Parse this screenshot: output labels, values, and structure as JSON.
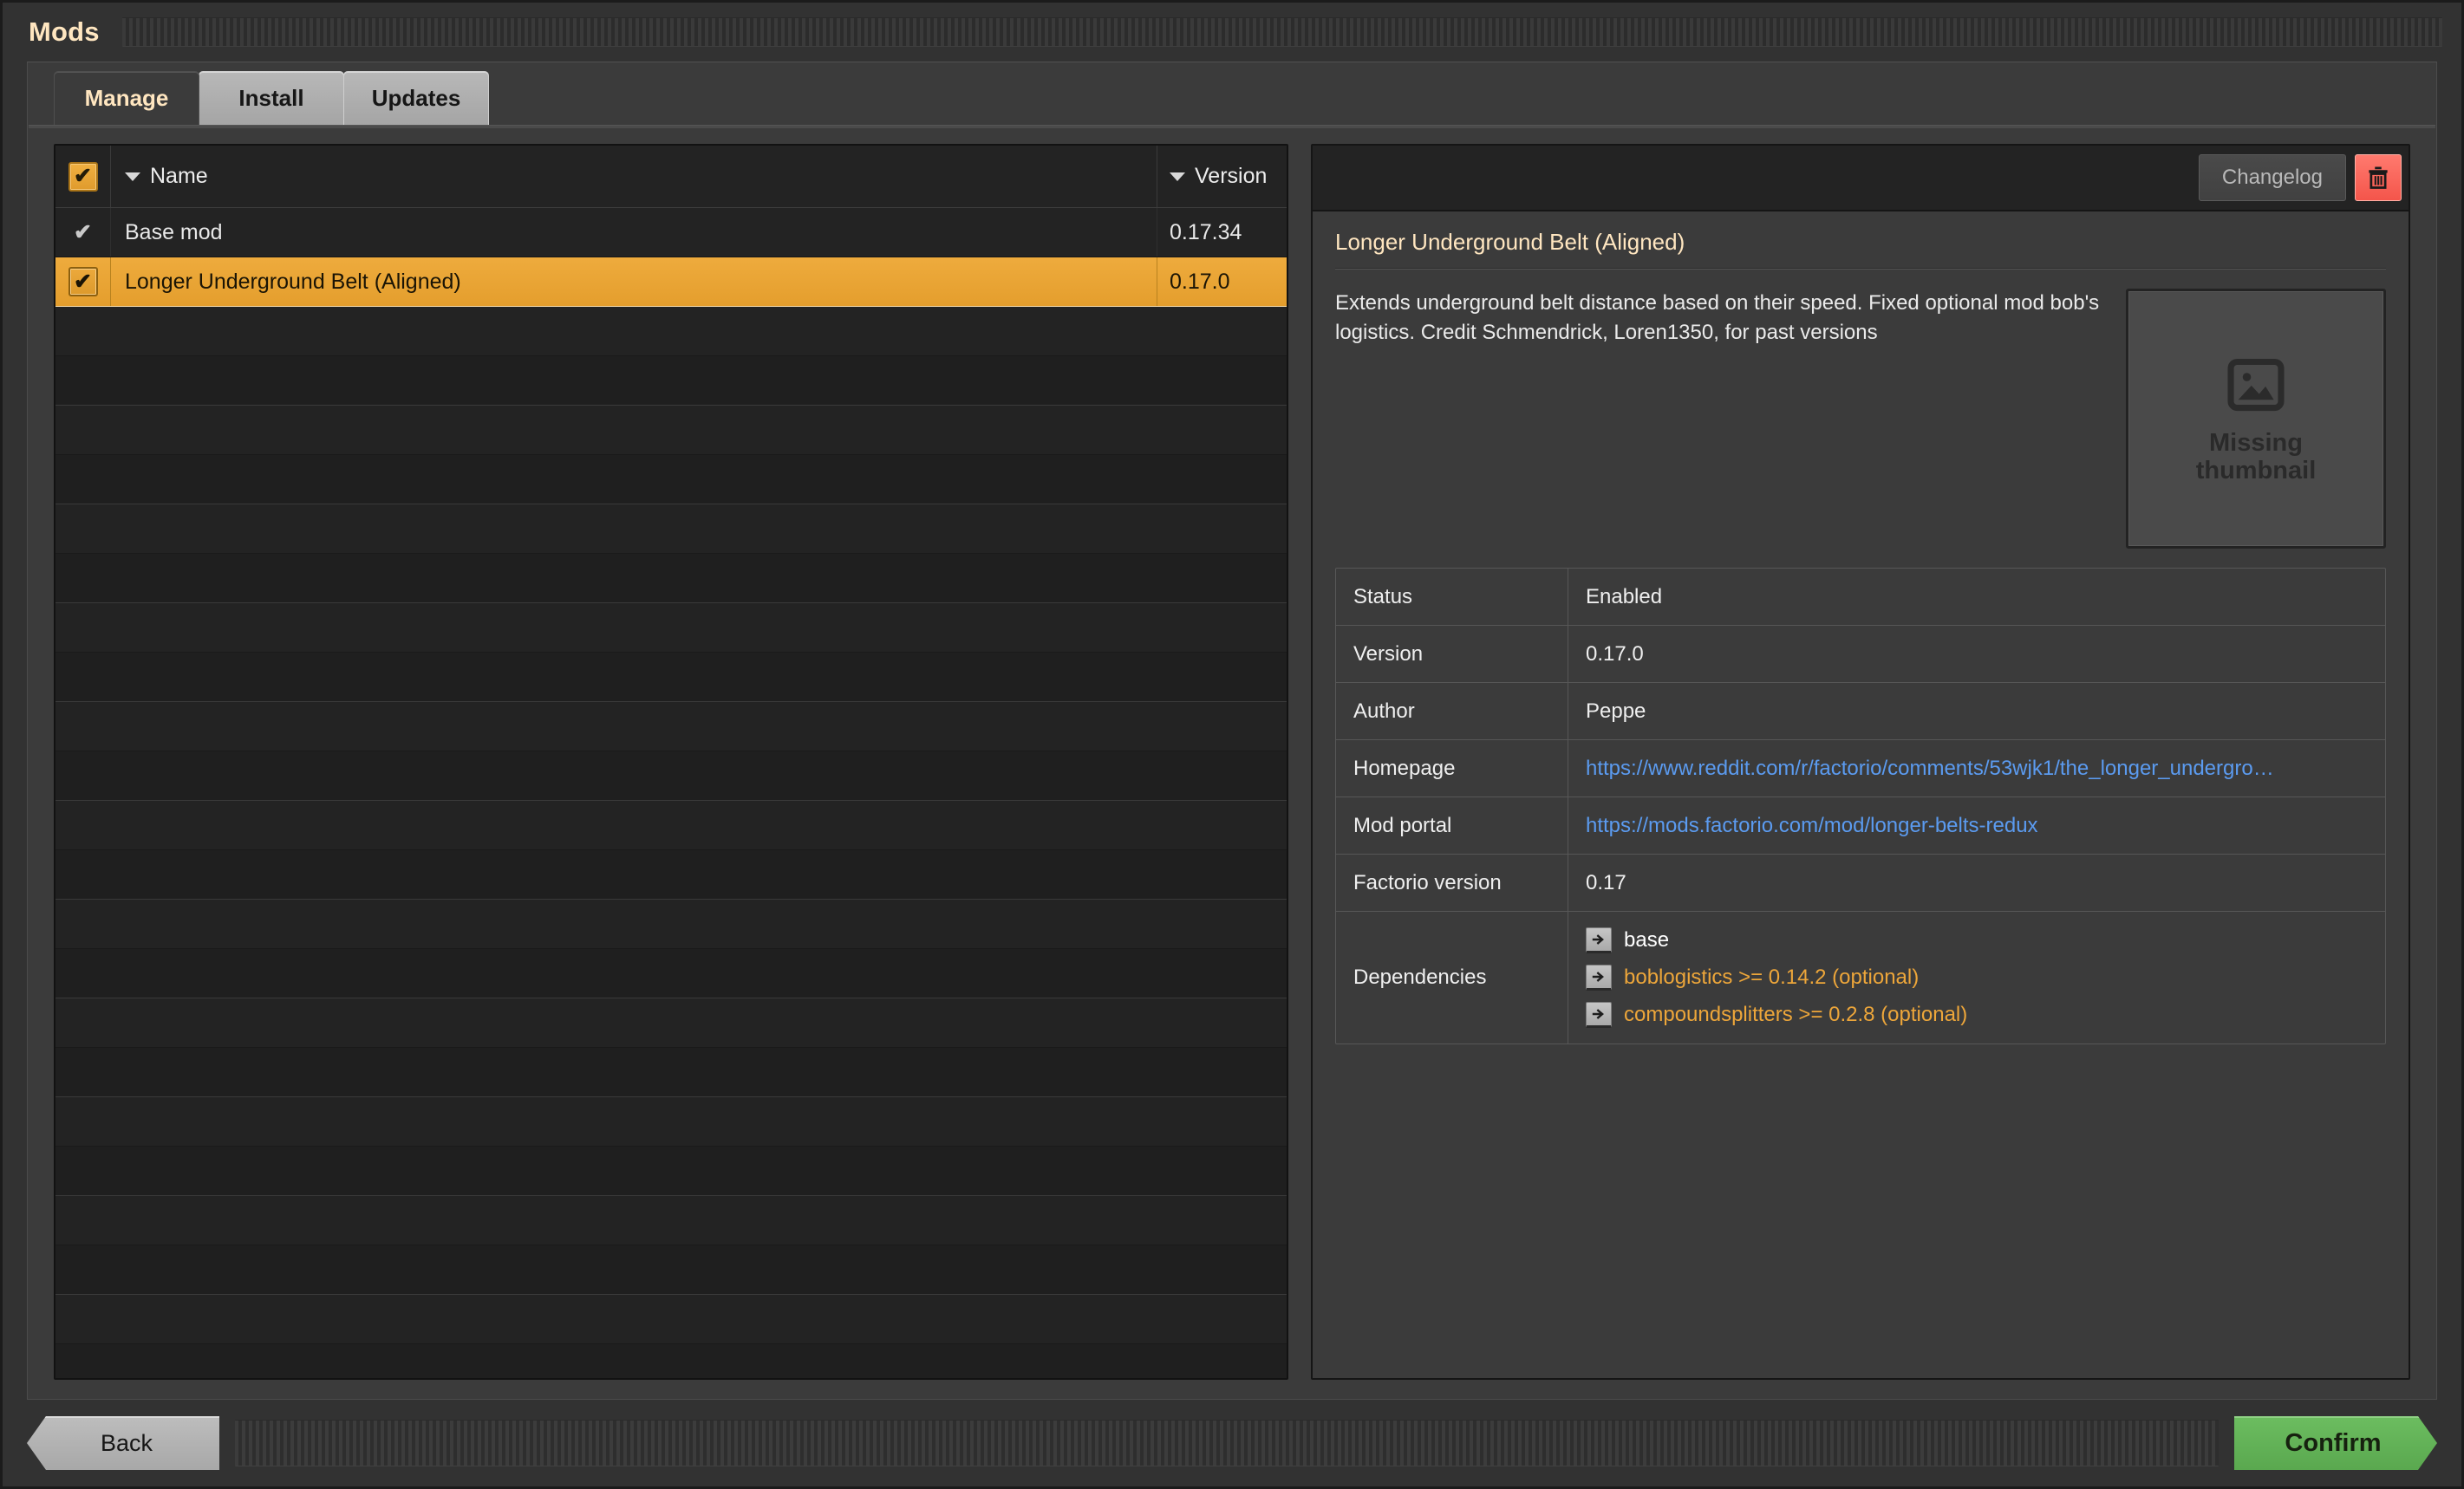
{
  "window": {
    "title": "Mods"
  },
  "tabs": [
    {
      "label": "Manage",
      "active": true
    },
    {
      "label": "Install",
      "active": false
    },
    {
      "label": "Updates",
      "active": false
    }
  ],
  "mod_list": {
    "header": {
      "select_all_checkbox": "✔",
      "name_column": "Name",
      "version_column": "Version",
      "name_sort_indicator": "descending-caret",
      "version_sort_indicator": "descending-caret"
    },
    "rows": [
      {
        "checkbox": "✔",
        "name": "Base mod",
        "version": "0.17.34",
        "selected": false,
        "checkbox_style": "plain"
      },
      {
        "checkbox": "✔",
        "name": "Longer Underground Belt (Aligned)",
        "version": "0.17.0",
        "selected": true,
        "checkbox_style": "boxed"
      }
    ],
    "empty_row_count": 23
  },
  "details": {
    "toolbar": {
      "changelog_label": "Changelog",
      "delete_icon": "trash-icon"
    },
    "title": "Longer Underground Belt (Aligned)",
    "description": "Extends underground belt distance based on their speed.  Fixed optional mod bob's logistics.  Credit Schmendrick, Loren1350, for past versions",
    "thumbnail": {
      "icon": "missing-image-icon",
      "caption": "Missing\nthumbnail"
    },
    "info": [
      {
        "key": "Status",
        "value": "Enabled",
        "type": "text"
      },
      {
        "key": "Version",
        "value": "0.17.0",
        "type": "text"
      },
      {
        "key": "Author",
        "value": "Peppe",
        "type": "text"
      },
      {
        "key": "Homepage",
        "value": "https://www.reddit.com/r/factorio/comments/53wjk1/the_longer_undergro…",
        "type": "link"
      },
      {
        "key": "Mod portal",
        "value": "https://mods.factorio.com/mod/longer-belts-redux",
        "type": "link"
      },
      {
        "key": "Factorio version",
        "value": "0.17",
        "type": "text"
      }
    ],
    "dependencies_key": "Dependencies",
    "dependencies": [
      {
        "label": "base",
        "optional": false,
        "icon": "arrow-right-icon"
      },
      {
        "label": "boblogistics >= 0.14.2 (optional)",
        "optional": true,
        "icon": "arrow-right-icon"
      },
      {
        "label": "compoundsplitters >= 0.2.8 (optional)",
        "optional": true,
        "icon": "arrow-right-icon"
      }
    ]
  },
  "footer": {
    "back_label": "Back",
    "confirm_label": "Confirm"
  },
  "colors": {
    "accent_orange": "#e9a337",
    "title_cream": "#ffe6c0",
    "link_blue": "#5b9bf0",
    "confirm_green": "#5aa84f",
    "delete_red": "#f4554b",
    "panel_dark": "#212121",
    "panel_mid": "#3b3b3b"
  }
}
